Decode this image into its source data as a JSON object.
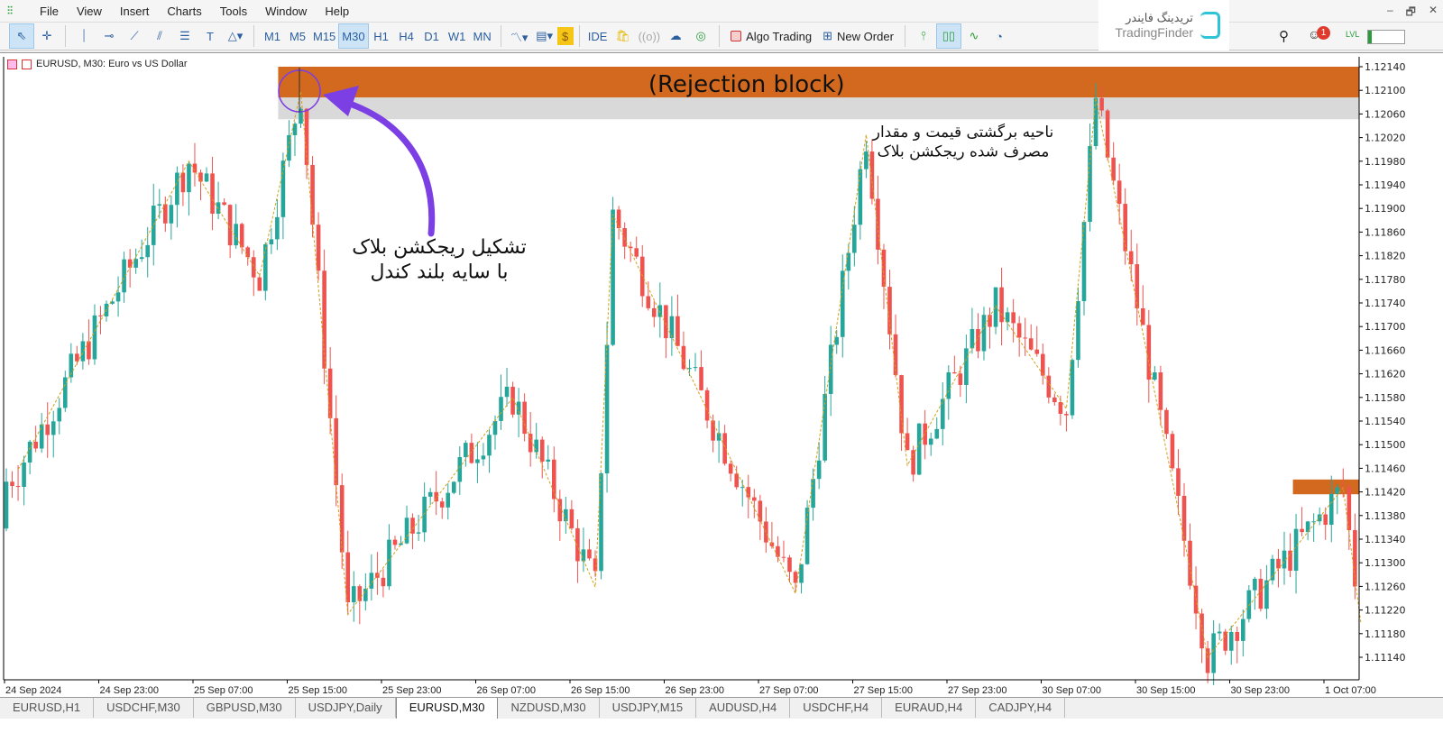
{
  "menu": {
    "items": [
      "File",
      "View",
      "Insert",
      "Charts",
      "Tools",
      "Window",
      "Help"
    ]
  },
  "window_controls": [
    "–",
    "🗗",
    "✕"
  ],
  "toolbar": {
    "timeframes": [
      "M1",
      "M5",
      "M15",
      "M30",
      "H1",
      "H4",
      "D1",
      "W1",
      "MN"
    ],
    "active_timeframe": "M30",
    "ide_label": "IDE",
    "algo_trading_label": "Algo Trading",
    "new_order_label": "New Order",
    "notification_count": "1",
    "lvl_label": "LVL"
  },
  "brand": {
    "name_fa": "تریدینگ فایندر",
    "name_en": "TradingFinder"
  },
  "chart": {
    "title": "EURUSD, M30:  Euro vs US Dollar",
    "price_labels": [
      "1.12140",
      "1.12100",
      "1.12060",
      "1.12020",
      "1.11980",
      "1.11940",
      "1.11900",
      "1.11860",
      "1.11820",
      "1.11780",
      "1.11740",
      "1.11700",
      "1.11660",
      "1.11620",
      "1.11580",
      "1.11540",
      "1.11500",
      "1.11460",
      "1.11420",
      "1.11380",
      "1.11340",
      "1.11300",
      "1.11260",
      "1.11220",
      "1.11180",
      "1.11140"
    ],
    "time_labels": [
      "24 Sep 2024",
      "24 Sep 23:00",
      "25 Sep 07:00",
      "25 Sep 15:00",
      "25 Sep 23:00",
      "26 Sep 07:00",
      "26 Sep 15:00",
      "26 Sep 23:00",
      "27 Sep 07:00",
      "27 Sep 15:00",
      "27 Sep 23:00",
      "30 Sep 07:00",
      "30 Sep 15:00",
      "30 Sep 23:00",
      "1 Oct 07:00"
    ],
    "zigzag": [
      [
        "24 Sep 16:00",
        1.11458
      ],
      [
        "25 Sep 06:30",
        1.1198
      ],
      [
        "25 Sep 12:30",
        1.11786
      ],
      [
        "25 Sep 16:00",
        1.12098
      ],
      [
        "25 Sep 20:00",
        1.11213
      ],
      [
        "26 Sep 10:00",
        1.1158
      ],
      [
        "26 Sep 17:00",
        1.11259
      ],
      [
        "26 Sep 18:30",
        1.1189
      ],
      [
        "27 Sep 10:00",
        1.11248
      ],
      [
        "27 Sep 16:00",
        1.12025
      ],
      [
        "27 Sep 19:30",
        1.11465
      ],
      [
        "30 Sep 03:00",
        1.11735
      ],
      [
        "30 Sep 09:00",
        1.11561
      ],
      [
        "30 Sep 11:30",
        1.12087
      ],
      [
        "30 Sep 21:00",
        1.1114
      ],
      [
        "1 Oct 08:30",
        1.11427
      ],
      [
        "1 Oct 10:00",
        1.11198
      ]
    ],
    "rejection_block": {
      "label": "(Rejection block)",
      "top": 1.1214,
      "bottom": 1.12088,
      "mitigated_bottom": 1.12051,
      "start": "25 Sep 15:00"
    },
    "right_block": {
      "top": 1.11441,
      "bottom": 1.11416,
      "start": "1 Oct 05:00"
    },
    "annotation_left": [
      "تشکیل ریجکشن بلاک",
      "با سایه بلند کندل"
    ],
    "annotation_right": [
      "ناحیه برگشتی قیمت و مقدار",
      "مصرف شده ریجکشن بلاک"
    ],
    "colors": {
      "bull": "#26a69a",
      "bear": "#ef5350",
      "block": "#d2691e",
      "mitigated": "#d9d9d9",
      "zigzag": "#d4a017",
      "arrow": "#7b3fe4"
    }
  },
  "tabs": {
    "items": [
      "EURUSD,H1",
      "USDCHF,M30",
      "GBPUSD,M30",
      "USDJPY,Daily",
      "EURUSD,M30",
      "NZDUSD,M30",
      "USDJPY,M15",
      "AUDUSD,H4",
      "USDCHF,H4",
      "EURAUD,H4",
      "CADJPY,H4"
    ],
    "active": "EURUSD,M30"
  }
}
